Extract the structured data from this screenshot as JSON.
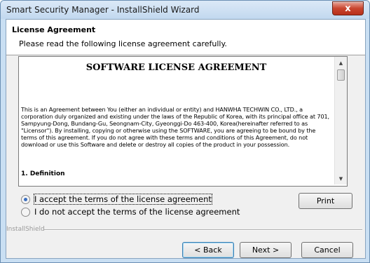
{
  "window": {
    "title": "Smart Security Manager - InstallShield Wizard",
    "close_glyph": "x"
  },
  "header": {
    "title": "License Agreement",
    "subtitle": "Please read the following license agreement carefully."
  },
  "license": {
    "heading": "SOFTWARE LICENSE AGREEMENT",
    "paragraph": "This is an Agreement between You (either an individual or entity) and HANWHA TECHWIN CO., LTD., a corporation duly organized and existing under the laws of the Republic of Korea, with its principal office at 701, Sampyung-Dong, Bundang-Gu, Seongnam-City, Gyeonggi-Do 463-400, Korea(hereinafter referred to as \"Licensor\"). By installing, copying or otherwise using the SOFTWARE, you are agreeing to be bound by the terms of this agreement. If you do not agree with these terms and conditions of this Agreement, do not download or use this Software and delete or destroy all copies of the product in your possession.",
    "section_title": "1. Definition",
    "scroll_up_glyph": "▲",
    "scroll_down_glyph": "▼"
  },
  "options": {
    "accept_label": "I accept the terms of the license agreement",
    "decline_label": "I do not accept the terms of the license agreement",
    "selected": "accept"
  },
  "buttons": {
    "print": "Print",
    "back": "< Back",
    "next": "Next >",
    "cancel": "Cancel"
  },
  "footer": {
    "brand": "InstallShield"
  },
  "colors": {
    "title_bar": "#c9dff3",
    "close_button": "#c9452f",
    "radio_dot": "#3b6fc0"
  }
}
